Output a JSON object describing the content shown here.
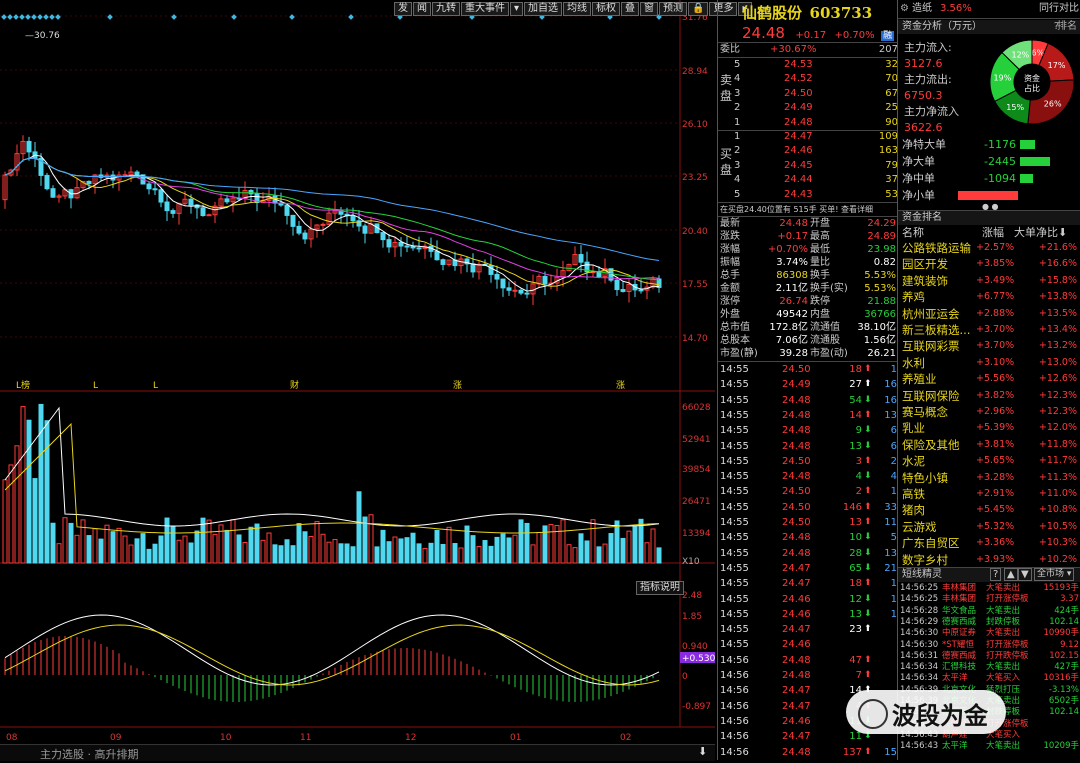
{
  "toolbar": {
    "buttons": [
      "发",
      "闻",
      "九转",
      "重大事件",
      "▾",
      "加自选",
      "均线",
      "标权",
      "叠",
      "窗",
      "预测",
      "🔒",
      "更多",
      "▸"
    ]
  },
  "main_chart": {
    "price_ticks": [
      "31.76",
      "28.94",
      "26.10",
      "23.25",
      "20.40",
      "17.55",
      "14.70"
    ],
    "high_label": "30.76",
    "event_markers": [
      "L榜",
      "L",
      "L",
      "财",
      "涨",
      "涨"
    ]
  },
  "volume_chart": {
    "ticks": [
      "66028",
      "52941",
      "39854",
      "26471",
      "13394",
      "X10"
    ]
  },
  "macd_chart": {
    "ticks": [
      "2.48",
      "1.85",
      "0.940",
      "0.530",
      "0",
      "-0.897"
    ],
    "current_value": "+0.530",
    "indicator_button": "指标说明"
  },
  "x_axis": {
    "labels": [
      "08",
      "09",
      "10",
      "11",
      "12",
      "01",
      "02"
    ]
  },
  "footer": {
    "text": "主力选股 · 高升排期",
    "download_icon": "⬇"
  },
  "stock": {
    "name": "仙鹤股份",
    "code": "603733",
    "price": "24.48",
    "change": "+0.17",
    "change_pct": "+0.70%",
    "badge": "融"
  },
  "order_book": {
    "weibi_label": "委比",
    "weibi_value": "+30.67%",
    "weibi_diff": "207",
    "sell_label": "卖盘",
    "buy_label": "买盘",
    "sells": [
      {
        "lv": "5",
        "price": "24.53",
        "vol": "32"
      },
      {
        "lv": "4",
        "price": "24.52",
        "vol": "70"
      },
      {
        "lv": "3",
        "price": "24.50",
        "vol": "67"
      },
      {
        "lv": "2",
        "price": "24.49",
        "vol": "25"
      },
      {
        "lv": "1",
        "price": "24.48",
        "vol": "90"
      }
    ],
    "buys": [
      {
        "lv": "1",
        "price": "24.47",
        "vol": "109"
      },
      {
        "lv": "2",
        "price": "24.46",
        "vol": "163"
      },
      {
        "lv": "3",
        "price": "24.45",
        "vol": "79"
      },
      {
        "lv": "4",
        "price": "24.44",
        "vol": "37"
      },
      {
        "lv": "5",
        "price": "24.43",
        "vol": "53"
      }
    ],
    "notice": "在买盘24.40位置有 515手 买单! 查看详细"
  },
  "quote": [
    {
      "l": "最新",
      "v": "24.48",
      "l2": "开盘",
      "v2": "24.29"
    },
    {
      "l": "涨跌",
      "v": "+0.17",
      "l2": "最高",
      "v2": "24.89"
    },
    {
      "l": "涨幅",
      "v": "+0.70%",
      "l2": "最低",
      "v2": "23.98"
    },
    {
      "l": "振幅",
      "v": "3.74%",
      "l2": "量比",
      "v2": "0.82"
    },
    {
      "l": "总手",
      "v": "86308",
      "l2": "换手",
      "v2": "5.53%"
    },
    {
      "l": "金额",
      "v": "2.11亿",
      "l2": "换手(实)",
      "v2": "5.53%"
    },
    {
      "l": "涨停",
      "v": "26.74",
      "l2": "跌停",
      "v2": "21.88"
    },
    {
      "l": "外盘",
      "v": "49542",
      "l2": "内盘",
      "v2": "36766"
    },
    {
      "l": "总市值",
      "v": "172.8亿",
      "l2": "流通值",
      "v2": "38.10亿"
    },
    {
      "l": "总股本",
      "v": "7.06亿",
      "l2": "流通股",
      "v2": "1.56亿"
    },
    {
      "l": "市盈(静)",
      "v": "39.28",
      "l2": "市盈(动)",
      "v2": "26.21"
    }
  ],
  "ticks": [
    {
      "t": "14:55",
      "p": "24.50",
      "v": "18",
      "d": "up",
      "n": "1"
    },
    {
      "t": "14:55",
      "p": "24.49",
      "v": "27",
      "d": "upw",
      "n": "16"
    },
    {
      "t": "14:55",
      "p": "24.48",
      "v": "54",
      "d": "dn",
      "n": "16"
    },
    {
      "t": "14:55",
      "p": "24.48",
      "v": "14",
      "d": "up",
      "n": "13"
    },
    {
      "t": "14:55",
      "p": "24.48",
      "v": "9",
      "d": "dn",
      "n": "6"
    },
    {
      "t": "14:55",
      "p": "24.48",
      "v": "13",
      "d": "dn",
      "n": "6"
    },
    {
      "t": "14:55",
      "p": "24.50",
      "v": "3",
      "d": "up",
      "n": "2"
    },
    {
      "t": "14:55",
      "p": "24.48",
      "v": "4",
      "d": "dn",
      "n": "4"
    },
    {
      "t": "14:55",
      "p": "24.50",
      "v": "2",
      "d": "up",
      "n": "1"
    },
    {
      "t": "14:55",
      "p": "24.50",
      "v": "146",
      "d": "up",
      "n": "33"
    },
    {
      "t": "14:55",
      "p": "24.50",
      "v": "13",
      "d": "up",
      "n": "11"
    },
    {
      "t": "14:55",
      "p": "24.48",
      "v": "10",
      "d": "dn",
      "n": "5"
    },
    {
      "t": "14:55",
      "p": "24.48",
      "v": "28",
      "d": "dn",
      "n": "13"
    },
    {
      "t": "14:55",
      "p": "24.47",
      "v": "65",
      "d": "dn",
      "n": "21"
    },
    {
      "t": "14:55",
      "p": "24.47",
      "v": "18",
      "d": "up",
      "n": "1"
    },
    {
      "t": "14:55",
      "p": "24.46",
      "v": "12",
      "d": "dn",
      "n": "1"
    },
    {
      "t": "14:55",
      "p": "24.46",
      "v": "13",
      "d": "dn",
      "n": "1"
    },
    {
      "t": "14:55",
      "p": "24.47",
      "v": "23",
      "d": "upw",
      "n": ""
    },
    {
      "t": "14:55",
      "p": "24.46",
      "v": "",
      "d": "",
      "n": ""
    },
    {
      "t": "14:56",
      "p": "24.48",
      "v": "47",
      "d": "up",
      "n": ""
    },
    {
      "t": "14:56",
      "p": "24.48",
      "v": "7",
      "d": "up",
      "n": ""
    },
    {
      "t": "14:56",
      "p": "24.47",
      "v": "14",
      "d": "upw",
      "n": ""
    },
    {
      "t": "14:56",
      "p": "24.47",
      "v": "4",
      "d": "up",
      "n": ""
    },
    {
      "t": "14:56",
      "p": "24.46",
      "v": "11",
      "d": "dn",
      "n": ""
    },
    {
      "t": "14:56",
      "p": "24.47",
      "v": "11",
      "d": "dn",
      "n": ""
    },
    {
      "t": "14:56",
      "p": "24.48",
      "v": "137",
      "d": "up",
      "n": "15"
    }
  ],
  "capital": {
    "header_left": "造纸",
    "header_pct": "3.56%",
    "header_right": "同行对比",
    "title": "资金分析（万元）",
    "inflow_label": "主力流入:",
    "inflow": "3127.6",
    "outflow_label": "主力流出:",
    "outflow": "6750.3",
    "net_label": "主力净流入",
    "net": "3622.6",
    "donut_center": "资金占比",
    "slices": [
      "6%",
      "17%",
      "26%",
      "15%",
      "19%",
      "12%"
    ],
    "bars": [
      {
        "l": "净特大单",
        "v": "-1176",
        "color": "#26d03a",
        "frac": 0.25
      },
      {
        "l": "净大单",
        "v": "-2445",
        "color": "#26d03a",
        "frac": 0.52
      },
      {
        "l": "净中单",
        "v": "-1094",
        "color": "#26d03a",
        "frac": 0.23
      },
      {
        "l": "净小单",
        "v": "4716",
        "color": "#ff3b3b",
        "frac": 1.0
      }
    ]
  },
  "sector": {
    "title": "资金排名",
    "cols": [
      "名称",
      "涨幅",
      "大单净比"
    ],
    "rows": [
      {
        "n": "公路铁路运输",
        "a": "+2.57%",
        "b": "+21.6%"
      },
      {
        "n": "园区开发",
        "a": "+3.85%",
        "b": "+16.6%"
      },
      {
        "n": "建筑装饰",
        "a": "+3.49%",
        "b": "+15.8%"
      },
      {
        "n": "养鸡",
        "a": "+6.77%",
        "b": "+13.8%"
      },
      {
        "n": "杭州亚运会",
        "a": "+2.88%",
        "b": "+13.5%"
      },
      {
        "n": "新三板精选...",
        "a": "+3.70%",
        "b": "+13.4%"
      },
      {
        "n": "互联网彩票",
        "a": "+3.70%",
        "b": "+13.2%"
      },
      {
        "n": "水利",
        "a": "+3.10%",
        "b": "+13.0%"
      },
      {
        "n": "养殖业",
        "a": "+5.56%",
        "b": "+12.6%"
      },
      {
        "n": "互联网保险",
        "a": "+3.82%",
        "b": "+12.3%"
      },
      {
        "n": "赛马概念",
        "a": "+2.96%",
        "b": "+12.3%"
      },
      {
        "n": "乳业",
        "a": "+5.39%",
        "b": "+12.0%"
      },
      {
        "n": "保险及其他",
        "a": "+3.81%",
        "b": "+11.8%"
      },
      {
        "n": "水泥",
        "a": "+5.65%",
        "b": "+11.7%"
      },
      {
        "n": "特色小镇",
        "a": "+3.28%",
        "b": "+11.3%"
      },
      {
        "n": "高铁",
        "a": "+2.91%",
        "b": "+11.0%"
      },
      {
        "n": "猪肉",
        "a": "+5.45%",
        "b": "+10.8%"
      },
      {
        "n": "云游戏",
        "a": "+5.32%",
        "b": "+10.5%"
      },
      {
        "n": "广东自贸区",
        "a": "+3.36%",
        "b": "+10.3%"
      },
      {
        "n": "数字乡村",
        "a": "+3.93%",
        "b": "+10.2%"
      }
    ]
  },
  "sprite": {
    "title": "短线精灵",
    "market": "全市场",
    "rows": [
      {
        "t": "14:56:25",
        "n": "丰林集团",
        "e": "大笔卖出",
        "v": "15193手",
        "c": "red"
      },
      {
        "t": "14:56:25",
        "n": "丰林集团",
        "e": "打开涨停板",
        "v": "3.37",
        "c": "red"
      },
      {
        "t": "14:56:28",
        "n": "华文食品",
        "e": "大笔卖出",
        "v": "424手",
        "c": "green"
      },
      {
        "t": "14:56:29",
        "n": "德赛西威",
        "e": "封跌停板",
        "v": "102.14",
        "c": "green"
      },
      {
        "t": "14:56:30",
        "n": "中原证券",
        "e": "大笔卖出",
        "v": "10990手",
        "c": "red"
      },
      {
        "t": "14:56:30",
        "n": "*ST耀恒",
        "e": "打开涨停板",
        "v": "9.12",
        "c": "red"
      },
      {
        "t": "14:56:31",
        "n": "德赛西威",
        "e": "打开跌停板",
        "v": "102.15",
        "c": "red"
      },
      {
        "t": "14:56:34",
        "n": "汇得科技",
        "e": "大笔卖出",
        "v": "427手",
        "c": "green"
      },
      {
        "t": "14:56:34",
        "n": "太平洋",
        "e": "大笔买入",
        "v": "10316手",
        "c": "red"
      },
      {
        "t": "14:56:39",
        "n": "北京文化",
        "e": "猛烈打压",
        "v": "-3.13%",
        "c": "green"
      },
      {
        "t": "14:56:39",
        "n": "北京文化",
        "e": "大笔卖出",
        "v": "6502手",
        "c": "green"
      },
      {
        "t": "14:56:41",
        "n": "德赛西威",
        "e": "封跌停板",
        "v": "102.14",
        "c": "green"
      },
      {
        "t": "14:56:41",
        "n": "共创草坪",
        "e": "打开涨停板",
        "v": "",
        "c": "red"
      },
      {
        "t": "14:56:43",
        "n": "葫芦娃",
        "e": "大笔买入",
        "v": "",
        "c": "red"
      },
      {
        "t": "14:56:43",
        "n": "太平洋",
        "e": "大笔卖出",
        "v": "10209手",
        "c": "green"
      }
    ]
  },
  "watermark": "波段为金"
}
